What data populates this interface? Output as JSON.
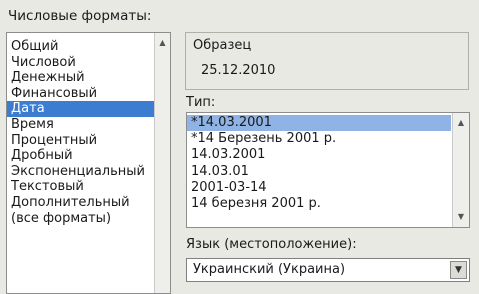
{
  "category_label": "Числовые форматы:",
  "categories": [
    "Общий",
    "Числовой",
    "Денежный",
    "Финансовый",
    "Дата",
    "Время",
    "Процентный",
    "Дробный",
    "Экспоненциальный",
    "Текстовый",
    "Дополнительный",
    "(все форматы)"
  ],
  "selected_category": "Дата",
  "sample": {
    "label": "Образец",
    "value": "25.12.2010"
  },
  "type": {
    "label": "Тип:",
    "items": [
      "*14.03.2001",
      "*14 Березень 2001 р.",
      "14.03.2001",
      "14.03.01",
      "2001-03-14",
      "14 березня 2001 р."
    ],
    "selected": "*14.03.2001"
  },
  "language": {
    "label": "Язык (местоположение):",
    "value": "Украинский (Украина)"
  },
  "icons": {
    "scroll_up": "scroll-up-arrow-icon",
    "scroll_down": "scroll-down-arrow-icon",
    "dropdown": "chevron-down-icon"
  },
  "colors": {
    "selection": "#3d7dd1",
    "type_selection": "#8fb3e4",
    "background": "#e9e9e4"
  }
}
